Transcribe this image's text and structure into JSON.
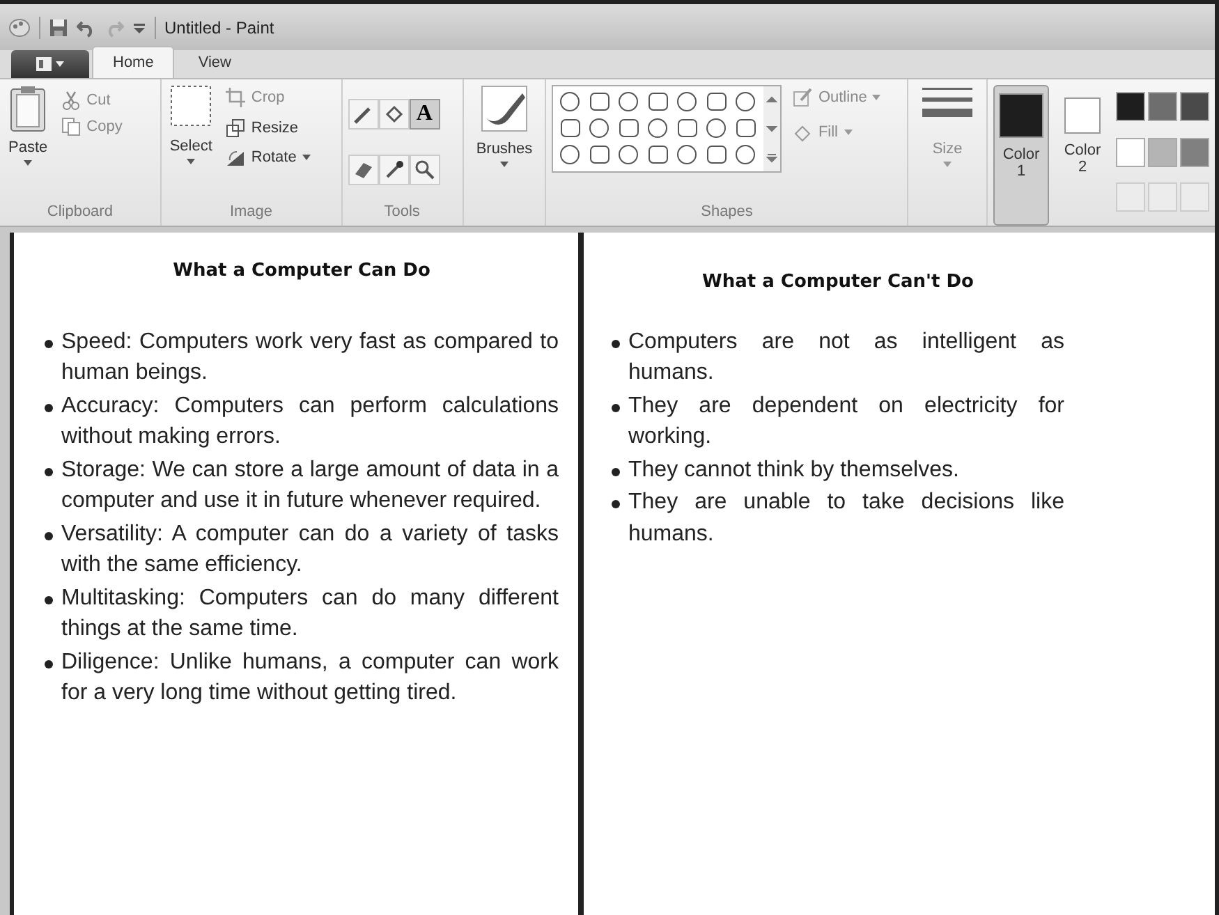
{
  "window": {
    "title": "Untitled - Paint"
  },
  "tabs": [
    {
      "label": "Home",
      "selected": true
    },
    {
      "label": "View",
      "selected": false
    }
  ],
  "clipboard": {
    "label": "Clipboard",
    "paste": "Paste",
    "items": [
      {
        "kind": "cut",
        "label": "Cut",
        "disabled": true
      },
      {
        "kind": "copy",
        "label": "Copy",
        "disabled": true
      }
    ]
  },
  "image": {
    "label": "Image",
    "select": "Select",
    "items": [
      {
        "kind": "crop",
        "label": "Crop",
        "disabled": true
      },
      {
        "kind": "resize",
        "label": "Resize",
        "disabled": false
      },
      {
        "kind": "rotate",
        "label": "Rotate",
        "disabled": false
      }
    ]
  },
  "tools": {
    "label": "Tools",
    "items": [
      {
        "kind": "pencil",
        "selected": false
      },
      {
        "kind": "fill",
        "selected": false
      },
      {
        "kind": "text",
        "glyph": "A",
        "selected": true
      },
      {
        "kind": "eraser",
        "selected": false
      },
      {
        "kind": "picker",
        "selected": false
      },
      {
        "kind": "magnifier",
        "selected": false
      }
    ]
  },
  "brushes": {
    "label": "Brushes"
  },
  "shapes": {
    "label": "Shapes",
    "outline": "Outline",
    "fill": "Fill"
  },
  "size": {
    "label": "Size"
  },
  "colors": [
    {
      "label": "Color",
      "number": "1",
      "color": "#1e1e1e",
      "selected": true
    },
    {
      "label": "Color",
      "number": "2",
      "color": "#ffffff",
      "selected": false
    }
  ],
  "palette": [
    {
      "color": "#1e1e1e"
    },
    {
      "color": "#6e6e6e"
    },
    {
      "color": "#4a4a4a"
    },
    {
      "color": "#ffffff"
    },
    {
      "color": "#b4b4b4"
    },
    {
      "color": "#808080"
    },
    {
      "kind": "empty"
    },
    {
      "kind": "empty"
    },
    {
      "kind": "empty"
    }
  ],
  "canvas": {
    "columns": [
      {
        "heading": "What a Computer Can Do",
        "items": [
          "Speed: Computers work very fast as compared to human beings.",
          "Accuracy: Computers can perform calculations without making errors.",
          "Storage: We can store a large amount of data in a computer and use it in future whenever required.",
          "Versatility: A computer can do a variety of tasks with the same efficiency.",
          "Multitasking: Computers can do many different things at the same time.",
          "Diligence: Unlike humans, a computer can work for a very long time without getting tired."
        ]
      },
      {
        "heading": "What a Computer Can't Do",
        "items": [
          "Computers are not as intelligent as humans.",
          "They are dependent on electricity for working.",
          "They cannot think by themselves.",
          "They are unable to take decisions like humans."
        ]
      }
    ]
  }
}
